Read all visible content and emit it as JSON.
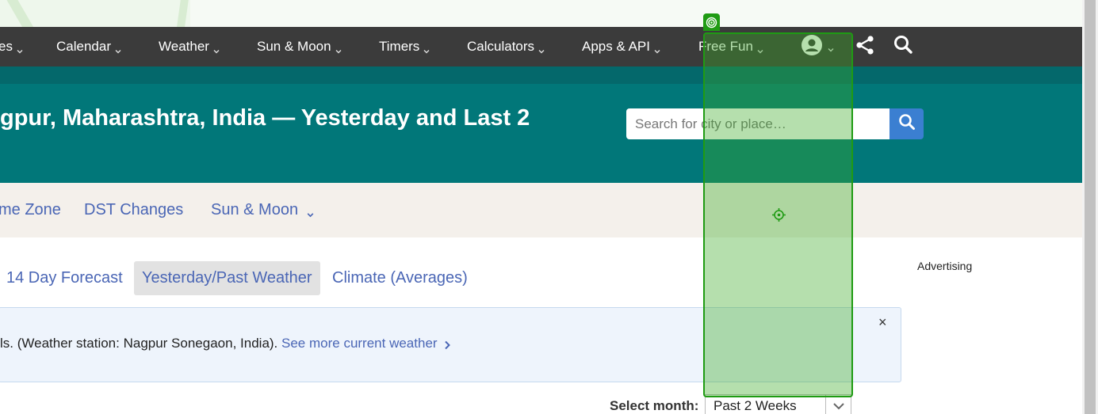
{
  "nav": {
    "items": [
      {
        "label": "es"
      },
      {
        "label": "Calendar"
      },
      {
        "label": "Weather"
      },
      {
        "label": "Sun & Moon"
      },
      {
        "label": "Timers"
      },
      {
        "label": "Calculators"
      },
      {
        "label": "Apps & API"
      },
      {
        "label": "Free Fun"
      }
    ]
  },
  "header": {
    "title": "gpur, Maharashtra, India — Yesterday and Last 2",
    "search_placeholder": "Search for city or place…"
  },
  "subnav": {
    "items": [
      {
        "label": "me Zone"
      },
      {
        "label": "DST Changes"
      },
      {
        "label": "Sun & Moon"
      }
    ]
  },
  "tabs": [
    {
      "label": "14 Day Forecast",
      "active": false
    },
    {
      "label": "Yesterday/Past Weather",
      "active": true
    },
    {
      "label": "Climate (Averages)",
      "active": false
    }
  ],
  "sidebar": {
    "advert_label": "Advertising"
  },
  "notice": {
    "text": "ls. (Weather station: Nagpur Sonegaon, India).",
    "link": "See more current weather",
    "close": "×"
  },
  "month_select": {
    "label": "Select month:",
    "value": "Past 2 Weeks"
  },
  "colors": {
    "nav_bg": "#3b3b3b",
    "header_bg": "#017779",
    "link": "#4a66b5",
    "search_button": "#3b7fd1",
    "highlight": "#1f9b13"
  },
  "icons": [
    "chevron-down-icon",
    "account-icon",
    "share-icon",
    "search-icon",
    "chevron-right-icon",
    "close-icon",
    "target-icon",
    "crosshair-icon"
  ]
}
